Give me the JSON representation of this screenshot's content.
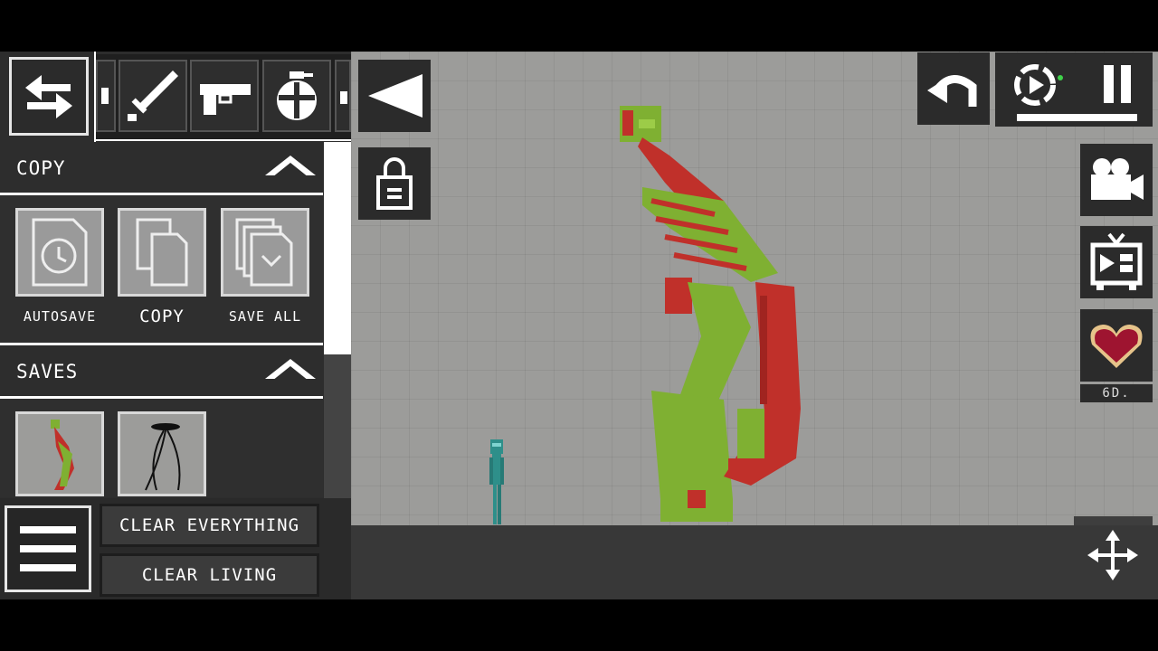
{
  "categories": [
    {
      "name": "swap"
    },
    {
      "name": "partial-item"
    },
    {
      "name": "melee"
    },
    {
      "name": "firearms"
    },
    {
      "name": "explosives"
    },
    {
      "name": "partial-item"
    }
  ],
  "copy_section": {
    "title": "COPY",
    "tiles": [
      {
        "label": "AUTOSAVE",
        "icon": "clock-file-icon"
      },
      {
        "label": "COPY",
        "icon": "copy-pages-icon"
      },
      {
        "label": "SAVE ALL",
        "icon": "stacked-download-icon"
      }
    ]
  },
  "saves_section": {
    "title": "SAVES",
    "items": [
      {
        "icon": "creature-thumbnail"
      },
      {
        "icon": "tripod-thumbnail"
      }
    ]
  },
  "bottom": {
    "clear_everything": "CLEAR EVERYTHING",
    "clear_living": "CLEAR LIVING"
  },
  "world_controls": {
    "collapse": "triangle-left-icon",
    "lock": "lock-icon",
    "undo": "undo-arrow-icon",
    "slow_motion": "slow-motion-icon",
    "pause": "pause-icon",
    "camera": "video-camera-icon",
    "tv": "tv-icon",
    "health": "heart-icon",
    "health_label": "6D.",
    "move": "move-arrows-icon"
  },
  "colors": {
    "world_bg": "#9c9c9a",
    "ground": "#383838",
    "panel": "#2d2d2d",
    "creature_green": "#7fb032",
    "creature_red": "#c0302a",
    "android_teal": "#2e8f8a"
  }
}
